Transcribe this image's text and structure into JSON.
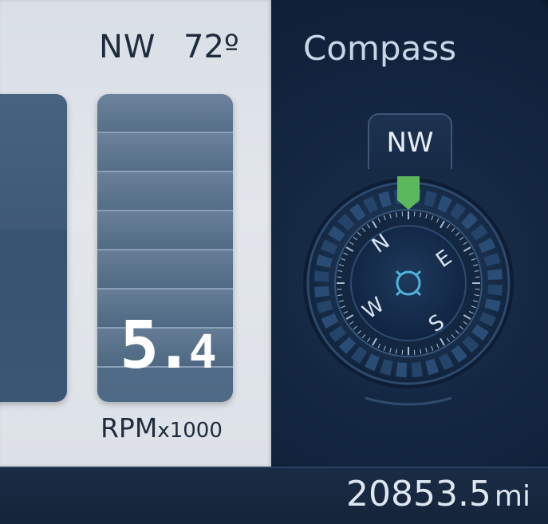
{
  "header": {
    "direction": "NW",
    "temperature": "72º"
  },
  "rpm": {
    "value_int": "5.",
    "value_dec": "4",
    "label": "RPM",
    "multiplier": "x1000",
    "level_fraction": 0.54
  },
  "compass": {
    "title": "Compass",
    "heading": "NW",
    "letters": {
      "n": "N",
      "e": "E",
      "s": "S",
      "w": "W"
    },
    "marker_color": "#5cb85c",
    "center_icon": "crosshair-circle-icon"
  },
  "odometer": {
    "value": "20853.5",
    "unit": "mi"
  },
  "colors": {
    "light_panel": "#e0e5eb",
    "dark_panel": "#142742",
    "accent_cyan": "#4fb3d9",
    "marker_green": "#5cb85c"
  }
}
